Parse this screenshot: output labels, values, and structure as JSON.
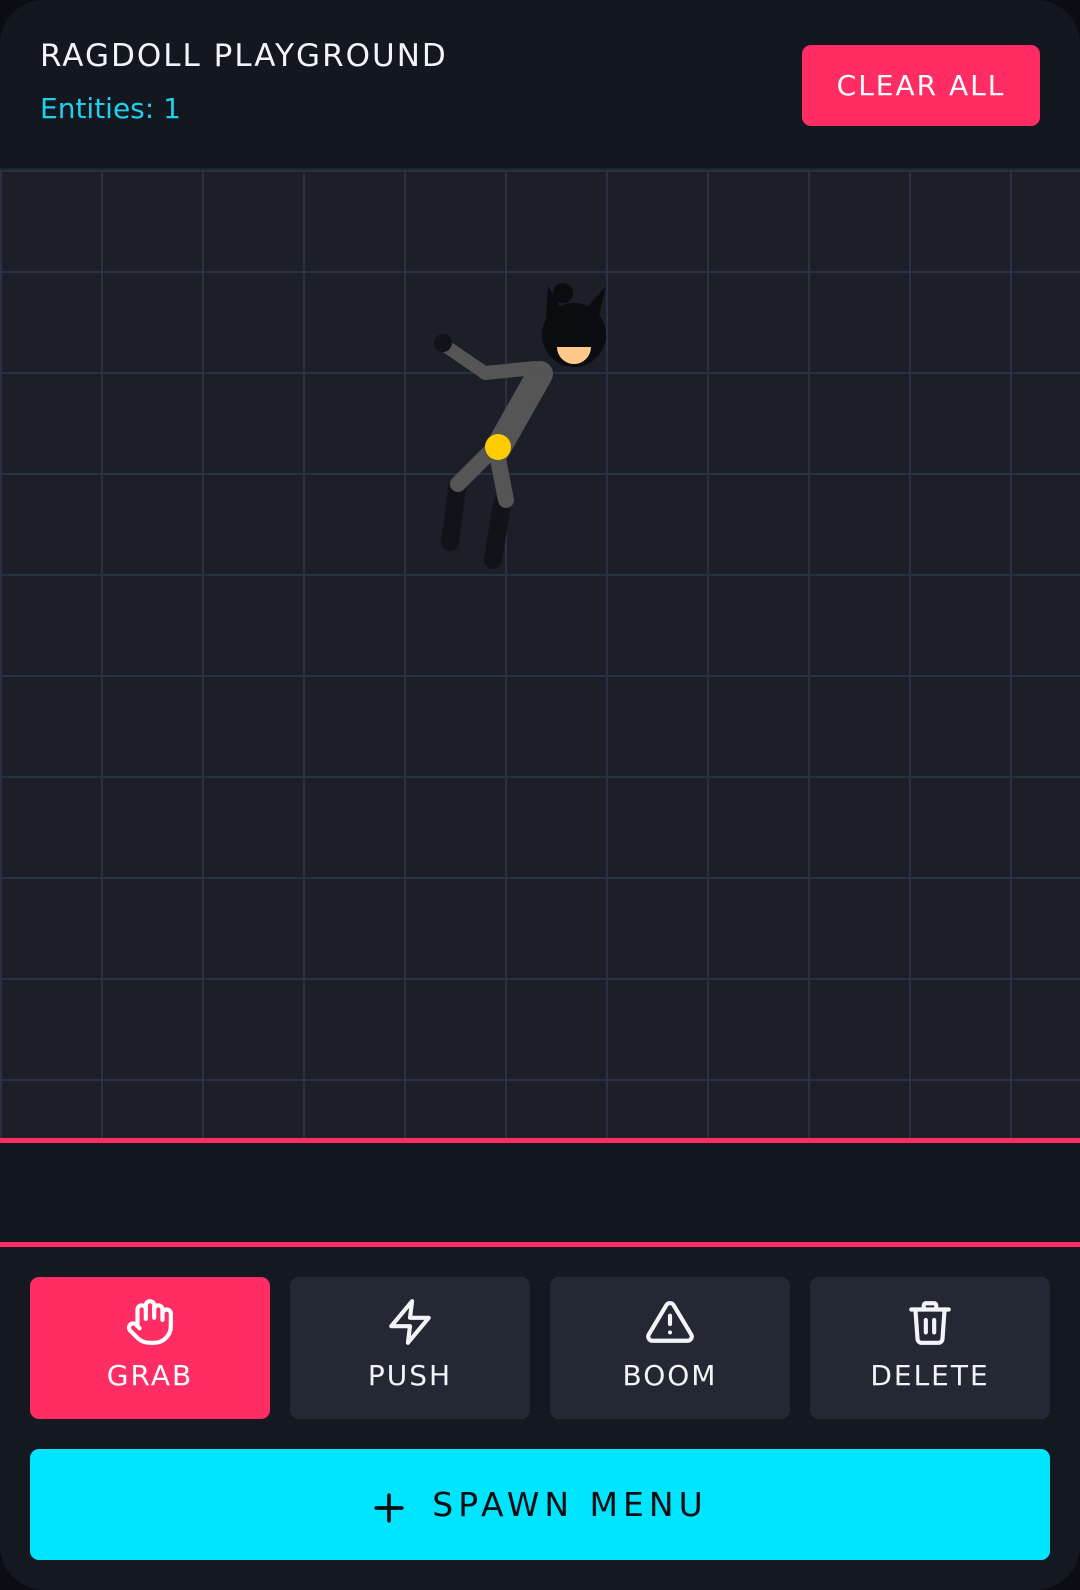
{
  "header": {
    "title": "RAGDOLL PLAYGROUND",
    "entities_label": "Entities: 1",
    "clear_label": "CLEAR ALL"
  },
  "canvas": {
    "entity_count": 1,
    "ragdoll_color": "#555555"
  },
  "tools": [
    {
      "id": "grab",
      "label": "GRAB",
      "icon": "hand-icon",
      "active": true
    },
    {
      "id": "push",
      "label": "PUSH",
      "icon": "lightning-icon",
      "active": false
    },
    {
      "id": "boom",
      "label": "BOOM",
      "icon": "warning-icon",
      "active": false
    },
    {
      "id": "delete",
      "label": "DELETE",
      "icon": "trash-icon",
      "active": false
    }
  ],
  "spawn": {
    "label": "SPAWN MENU",
    "icon": "plus-icon"
  },
  "colors": {
    "accent": "#ff2d63",
    "cyan": "#00e5ff",
    "entity_text": "#1fd0ea",
    "background": "#141821",
    "grid_line": "#283244"
  }
}
